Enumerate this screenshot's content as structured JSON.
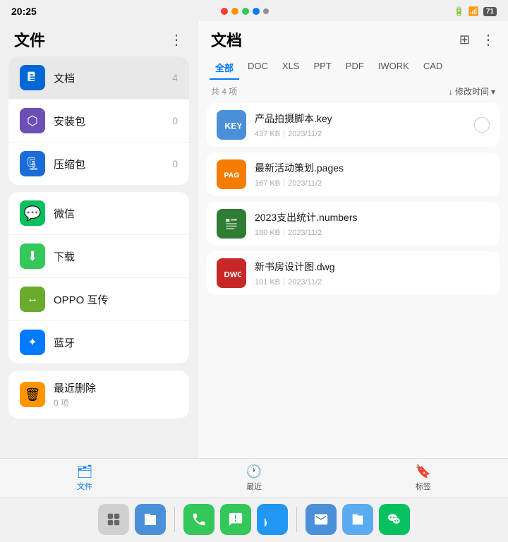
{
  "statusBar": {
    "time": "20:25",
    "rightIcons": "battery wifi"
  },
  "leftPanel": {
    "title": "文件",
    "fileCategories": [
      {
        "id": "docs",
        "label": "文档",
        "count": "4",
        "iconType": "doc",
        "active": true
      },
      {
        "id": "apk",
        "label": "安装包",
        "count": "0",
        "iconType": "pkg",
        "active": false
      },
      {
        "id": "zip",
        "label": "压缩包",
        "count": "0",
        "iconType": "zip",
        "active": false
      }
    ],
    "apps": [
      {
        "id": "wechat",
        "label": "微信",
        "iconType": "wechat"
      },
      {
        "id": "download",
        "label": "下载",
        "iconType": "download"
      },
      {
        "id": "oppo",
        "label": "OPPO 互传",
        "iconType": "oppo"
      },
      {
        "id": "bluetooth",
        "label": "蓝牙",
        "iconType": "bt"
      }
    ],
    "trash": {
      "label": "最近删除",
      "sublabel": "0 项"
    }
  },
  "rightPanel": {
    "title": "文档",
    "tabs": [
      {
        "id": "all",
        "label": "全部",
        "active": true
      },
      {
        "id": "doc",
        "label": "DOC",
        "active": false
      },
      {
        "id": "xls",
        "label": "XLS",
        "active": false
      },
      {
        "id": "ppt",
        "label": "PPT",
        "active": false
      },
      {
        "id": "pdf",
        "label": "PDF",
        "active": false
      },
      {
        "id": "iwork",
        "label": "IWORK",
        "active": false
      },
      {
        "id": "cad",
        "label": "CAD",
        "active": false
      }
    ],
    "countLabel": "共 4 项",
    "sortLabel": "↓ 修改时间",
    "files": [
      {
        "id": "file1",
        "name": "产品拍摄脚本.key",
        "size": "437 KB",
        "date": "2023/11/2",
        "iconType": "key",
        "hasSelect": true
      },
      {
        "id": "file2",
        "name": "最新活动策划.pages",
        "size": "167 KB",
        "date": "2023/11/2",
        "iconType": "pages",
        "hasSelect": false
      },
      {
        "id": "file3",
        "name": "2023支出统计.numbers",
        "size": "180 KB",
        "date": "2023/11/2",
        "iconType": "numbers",
        "hasSelect": false
      },
      {
        "id": "file4",
        "name": "新书房设计图.dwg",
        "size": "101 KB",
        "date": "2023/11/2",
        "iconType": "dwg",
        "hasSelect": false
      }
    ]
  },
  "bottomNav": {
    "items": [
      {
        "id": "files",
        "label": "文件",
        "active": true,
        "icon": "🗂"
      },
      {
        "id": "recent",
        "label": "最近",
        "active": false,
        "icon": "🕐"
      },
      {
        "id": "tags",
        "label": "标签",
        "active": false,
        "icon": "🔖"
      }
    ]
  },
  "dock": {
    "groups": [
      [
        {
          "id": "grid",
          "icon": "⊞",
          "type": "grid"
        },
        {
          "id": "files",
          "icon": "📁",
          "type": "files"
        }
      ],
      [
        {
          "id": "phone",
          "icon": "📞",
          "type": "phone"
        },
        {
          "id": "msg",
          "icon": "💬",
          "type": "msg"
        },
        {
          "id": "chat",
          "icon": "✈",
          "type": "chat"
        }
      ],
      [
        {
          "id": "mail",
          "icon": "✉",
          "type": "mail"
        },
        {
          "id": "fm",
          "icon": "📁",
          "type": "fm"
        },
        {
          "id": "wechat",
          "icon": "💚",
          "type": "wechat"
        }
      ]
    ]
  }
}
